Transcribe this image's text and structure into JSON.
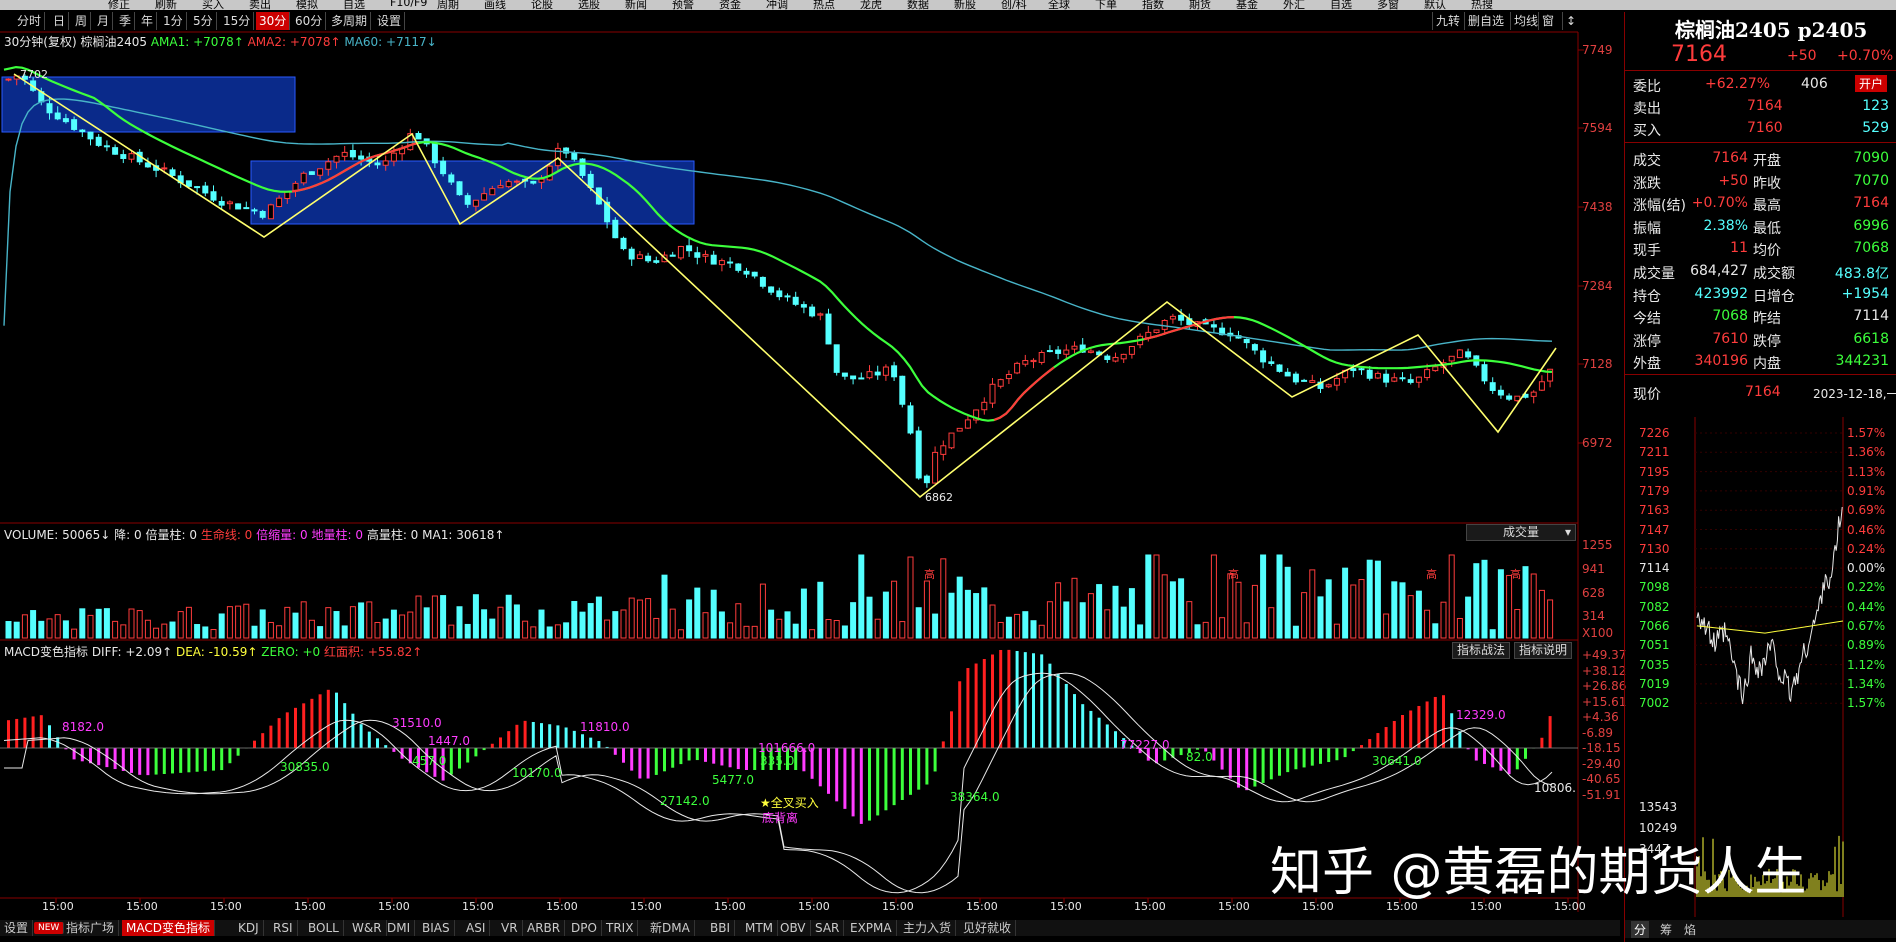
{
  "window": {
    "toolbar_items": [
      "修正",
      "刷新",
      "买入",
      "卖出",
      "模拟",
      "自选",
      "F10/F9",
      "周期",
      "画线",
      "论股",
      "选股",
      "新闻",
      "预警",
      "资金",
      "冲调",
      "热点",
      "龙虎",
      "数据",
      "新股",
      "创/科",
      "全球",
      "下单",
      "指数",
      "期货",
      "基金",
      "外汇",
      "自选",
      "多窗",
      "默认",
      "热搜"
    ]
  },
  "period_tabs": {
    "items": [
      "分时",
      "日",
      "周",
      "月",
      "季",
      "年",
      "1分",
      "5分",
      "15分",
      "30分",
      "60分",
      "多周期",
      "设置"
    ],
    "active": "30分"
  },
  "right_tools": [
    "九转",
    "删自选",
    "均线",
    "窗",
    "↕"
  ],
  "main_chart": {
    "info_line": {
      "period": "30分钟(复权)",
      "symbol": "棕榈油2405",
      "ama1": "AMA1: +7078↑",
      "ama2": "AMA2: +7078↑",
      "ma60": "MA60: +7117↓"
    },
    "price_axis": [
      "7749",
      "7594",
      "7438",
      "7284",
      "7128",
      "6972"
    ],
    "high_label": "7702",
    "low_label": "6862"
  },
  "volume_panel": {
    "labels": {
      "volume": "VOLUME: 50065↓",
      "jiang": "降: 0",
      "beiliang": "倍量柱: 0",
      "shengming": "生命线: 0",
      "beisuo": "倍缩量: 0",
      "diliang": "地量柱: 0",
      "gaoliang": "高量柱: 0",
      "ma1": "MA1: 30618↑"
    },
    "selector": "成交量",
    "axis": [
      "1255",
      "941",
      "628",
      "314",
      "X100"
    ],
    "gao_label": "高"
  },
  "macd_panel": {
    "labels": {
      "name": "MACD变色指标",
      "diff": "DIFF: +2.09↑",
      "dea": "DEA: -10.59↑",
      "zero": "ZERO: +0",
      "hong": "红面积: +55.82↑"
    },
    "buttons": [
      "指标战法",
      "指标说明"
    ],
    "axis": [
      "+49.37",
      "+38.12",
      "+26.86",
      "+15.61",
      "+4.36",
      "-6.89",
      "-18.15",
      "-29.40",
      "-40.65",
      "-51.91"
    ],
    "area_labels": [
      {
        "text": "8182.0",
        "color": "#ff3cff"
      },
      {
        "text": "30835.0",
        "color": "#3cff3c"
      },
      {
        "text": "31510.0",
        "color": "#ff3cff"
      },
      {
        "text": "1447.0",
        "color": "#ff3cff"
      },
      {
        "text": "457.0",
        "color": "#3cff3c"
      },
      {
        "text": "10170.0",
        "color": "#3cff3c"
      },
      {
        "text": "11810.0",
        "color": "#ff3cff"
      },
      {
        "text": "27142.0",
        "color": "#3cff3c"
      },
      {
        "text": "5477.0",
        "color": "#3cff3c"
      },
      {
        "text": "101666.0",
        "color": "#ff3cff"
      },
      {
        "text": "335.0",
        "color": "#3cff3c"
      },
      {
        "text": "38364.0",
        "color": "#3cff3c"
      },
      {
        "text": "77227.0",
        "color": "#ff3cff"
      },
      {
        "text": "82.0",
        "color": "#3cff3c"
      },
      {
        "text": "30641.0",
        "color": "#3cff3c"
      },
      {
        "text": "12329.0",
        "color": "#ff3cff"
      },
      {
        "text": "10806.",
        "color": "#e8e8e8"
      }
    ],
    "signal_buy": "全叉买入",
    "signal_div": "底背离"
  },
  "time_axis": [
    "15:00",
    "15:00",
    "15:00",
    "15:00",
    "15:00",
    "15:00",
    "15:00",
    "15:00",
    "15:00",
    "15:00",
    "15:00",
    "15:00",
    "15:00",
    "15:00",
    "15:00",
    "15:00",
    "15:00",
    "15:00",
    "15:00",
    "15:00",
    "15:00"
  ],
  "bottom_tabs": {
    "items": [
      "设置",
      "NEW",
      "指标广场",
      "MACD变色指标",
      "KDJ",
      "RSI",
      "BOLL",
      "W&R",
      "DMI",
      "BIAS",
      "ASI",
      "VR",
      "ARBR",
      "DPO",
      "TRIX",
      "新DMA",
      "BBI",
      "MTM",
      "OBV",
      "SAR",
      "EXPMA",
      "主力入货",
      "见好就收"
    ],
    "active": "MACD变色指标"
  },
  "quote_panel": {
    "title": "棕榈油2405 p2405",
    "price": "7164",
    "change": "+50",
    "change_pct": "+0.70%",
    "weibi_label": "委比",
    "weibi_value": "+62.27%",
    "weicha": "406",
    "open_btn": "开户",
    "sell_label": "卖出",
    "sell_price": "7164",
    "sell_vol": "123",
    "buy_label": "买入",
    "buy_price": "7160",
    "buy_vol": "529",
    "rows": [
      {
        "l1": "成交",
        "v1": "7164",
        "c1": "red",
        "l2": "开盘",
        "v2": "7090",
        "c2": "green"
      },
      {
        "l1": "涨跌",
        "v1": "+50",
        "c1": "red",
        "l2": "昨收",
        "v2": "7070",
        "c2": "green"
      },
      {
        "l1": "涨幅(结)",
        "v1": "+0.70%",
        "c1": "red",
        "l2": "最高",
        "v2": "7164",
        "c2": "red"
      },
      {
        "l1": "振幅",
        "v1": "2.38%",
        "c1": "cyan",
        "l2": "最低",
        "v2": "6996",
        "c2": "green"
      },
      {
        "l1": "现手",
        "v1": "11",
        "c1": "red",
        "l2": "均价",
        "v2": "7068",
        "c2": "green"
      },
      {
        "l1": "成交量",
        "v1": "684,427",
        "c1": "white",
        "l2": "成交额",
        "v2": "483.8亿",
        "c2": "cyan"
      },
      {
        "l1": "持仓",
        "v1": "423992",
        "c1": "cyan",
        "l2": "日增仓",
        "v2": "+1954",
        "c2": "cyan"
      },
      {
        "l1": "今结",
        "v1": "7068",
        "c1": "green",
        "l2": "昨结",
        "v2": "7114",
        "c2": "white"
      },
      {
        "l1": "涨停",
        "v1": "7610",
        "c1": "red",
        "l2": "跌停",
        "v2": "6618",
        "c2": "green"
      },
      {
        "l1": "外盘",
        "v1": "340196",
        "c1": "red",
        "l2": "内盘",
        "v2": "344231",
        "c2": "green"
      }
    ],
    "now_label": "现价",
    "now_value": "7164",
    "date": "2023-12-18,一",
    "mini_prices": [
      "7226",
      "7211",
      "7195",
      "7179",
      "7163",
      "7147",
      "7130",
      "7114",
      "7098",
      "7082",
      "7066",
      "7051",
      "7035",
      "7019",
      "7002"
    ],
    "mini_pcts": [
      "1.57%",
      "1.36%",
      "1.13%",
      "0.91%",
      "0.69%",
      "0.46%",
      "0.24%",
      "0.00%",
      "0.22%",
      "0.44%",
      "0.67%",
      "0.89%",
      "1.12%",
      "1.34%",
      "1.57%"
    ],
    "mini_vols": [
      "13543",
      "10249",
      "3447"
    ],
    "bottom_tabs": [
      "分",
      "筹",
      "焰"
    ]
  },
  "watermark": "知乎 @黄磊的期货人生",
  "colors": {
    "bg": "#000000",
    "up": "#ff3c3c",
    "down": "#54ffff",
    "ama": "#3cff3c",
    "ma60": "#48b4c8",
    "zigzag": "#ffff6e",
    "box": "#0a2a8a"
  }
}
